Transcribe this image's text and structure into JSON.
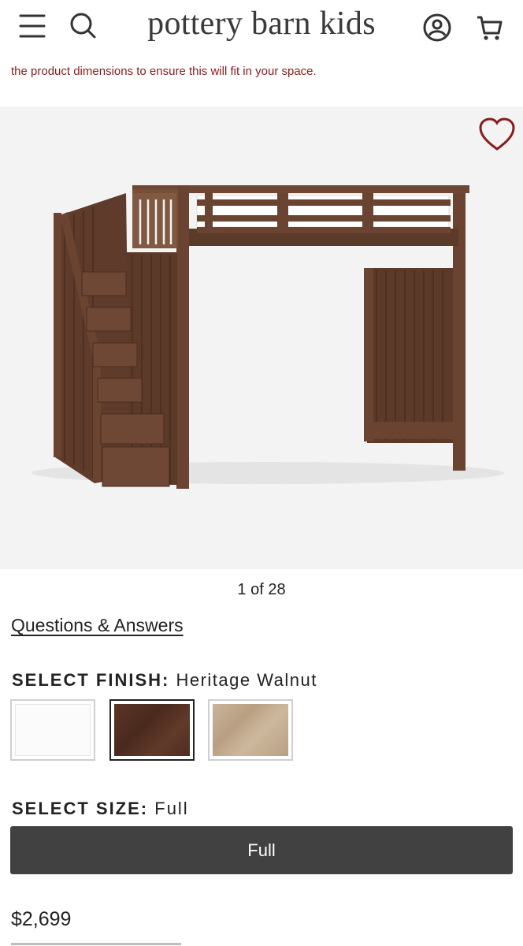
{
  "header": {
    "logo": "pottery barn kids",
    "icons": [
      "menu-icon",
      "search-icon",
      "account-icon",
      "cart-icon"
    ]
  },
  "notice": {
    "text": "the product dimensions to ensure this will fit in your space."
  },
  "gallery": {
    "counter": "1 of 28",
    "icon": "heart-icon"
  },
  "qa": {
    "label": "Questions & Answers"
  },
  "finish": {
    "label": "SELECT FINISH:",
    "selected": "Heritage Walnut",
    "swatch_colors": [
      "#fbfbfb",
      "#4e2d20",
      "#c2aa8c"
    ]
  },
  "size": {
    "label": "SELECT SIZE:",
    "selected": "Full",
    "button_label": "Full"
  },
  "price": {
    "value": "$2,699"
  },
  "colors": {
    "notice": "#8b1b1b",
    "button": "#414141",
    "heart": "#8b1b1b"
  }
}
